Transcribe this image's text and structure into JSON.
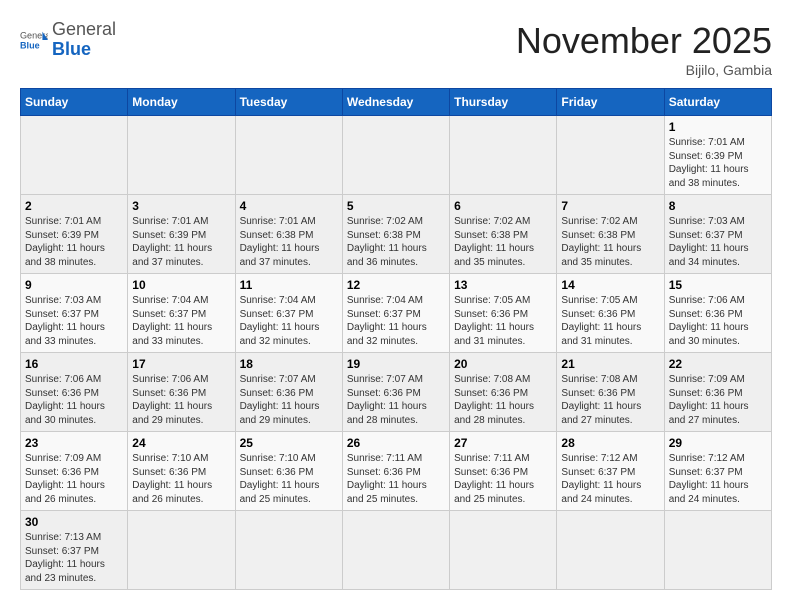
{
  "header": {
    "logo_general": "General",
    "logo_blue": "Blue",
    "month_title": "November 2025",
    "location": "Bijilo, Gambia"
  },
  "weekdays": [
    "Sunday",
    "Monday",
    "Tuesday",
    "Wednesday",
    "Thursday",
    "Friday",
    "Saturday"
  ],
  "weeks": [
    [
      {
        "day": "",
        "info": ""
      },
      {
        "day": "",
        "info": ""
      },
      {
        "day": "",
        "info": ""
      },
      {
        "day": "",
        "info": ""
      },
      {
        "day": "",
        "info": ""
      },
      {
        "day": "",
        "info": ""
      },
      {
        "day": "1",
        "info": "Sunrise: 7:01 AM\nSunset: 6:39 PM\nDaylight: 11 hours\nand 38 minutes."
      }
    ],
    [
      {
        "day": "2",
        "info": "Sunrise: 7:01 AM\nSunset: 6:39 PM\nDaylight: 11 hours\nand 38 minutes."
      },
      {
        "day": "3",
        "info": "Sunrise: 7:01 AM\nSunset: 6:39 PM\nDaylight: 11 hours\nand 37 minutes."
      },
      {
        "day": "4",
        "info": "Sunrise: 7:01 AM\nSunset: 6:38 PM\nDaylight: 11 hours\nand 37 minutes."
      },
      {
        "day": "5",
        "info": "Sunrise: 7:02 AM\nSunset: 6:38 PM\nDaylight: 11 hours\nand 36 minutes."
      },
      {
        "day": "6",
        "info": "Sunrise: 7:02 AM\nSunset: 6:38 PM\nDaylight: 11 hours\nand 35 minutes."
      },
      {
        "day": "7",
        "info": "Sunrise: 7:02 AM\nSunset: 6:38 PM\nDaylight: 11 hours\nand 35 minutes."
      },
      {
        "day": "8",
        "info": "Sunrise: 7:03 AM\nSunset: 6:37 PM\nDaylight: 11 hours\nand 34 minutes."
      }
    ],
    [
      {
        "day": "9",
        "info": "Sunrise: 7:03 AM\nSunset: 6:37 PM\nDaylight: 11 hours\nand 33 minutes."
      },
      {
        "day": "10",
        "info": "Sunrise: 7:04 AM\nSunset: 6:37 PM\nDaylight: 11 hours\nand 33 minutes."
      },
      {
        "day": "11",
        "info": "Sunrise: 7:04 AM\nSunset: 6:37 PM\nDaylight: 11 hours\nand 32 minutes."
      },
      {
        "day": "12",
        "info": "Sunrise: 7:04 AM\nSunset: 6:37 PM\nDaylight: 11 hours\nand 32 minutes."
      },
      {
        "day": "13",
        "info": "Sunrise: 7:05 AM\nSunset: 6:36 PM\nDaylight: 11 hours\nand 31 minutes."
      },
      {
        "day": "14",
        "info": "Sunrise: 7:05 AM\nSunset: 6:36 PM\nDaylight: 11 hours\nand 31 minutes."
      },
      {
        "day": "15",
        "info": "Sunrise: 7:06 AM\nSunset: 6:36 PM\nDaylight: 11 hours\nand 30 minutes."
      }
    ],
    [
      {
        "day": "16",
        "info": "Sunrise: 7:06 AM\nSunset: 6:36 PM\nDaylight: 11 hours\nand 30 minutes."
      },
      {
        "day": "17",
        "info": "Sunrise: 7:06 AM\nSunset: 6:36 PM\nDaylight: 11 hours\nand 29 minutes."
      },
      {
        "day": "18",
        "info": "Sunrise: 7:07 AM\nSunset: 6:36 PM\nDaylight: 11 hours\nand 29 minutes."
      },
      {
        "day": "19",
        "info": "Sunrise: 7:07 AM\nSunset: 6:36 PM\nDaylight: 11 hours\nand 28 minutes."
      },
      {
        "day": "20",
        "info": "Sunrise: 7:08 AM\nSunset: 6:36 PM\nDaylight: 11 hours\nand 28 minutes."
      },
      {
        "day": "21",
        "info": "Sunrise: 7:08 AM\nSunset: 6:36 PM\nDaylight: 11 hours\nand 27 minutes."
      },
      {
        "day": "22",
        "info": "Sunrise: 7:09 AM\nSunset: 6:36 PM\nDaylight: 11 hours\nand 27 minutes."
      }
    ],
    [
      {
        "day": "23",
        "info": "Sunrise: 7:09 AM\nSunset: 6:36 PM\nDaylight: 11 hours\nand 26 minutes."
      },
      {
        "day": "24",
        "info": "Sunrise: 7:10 AM\nSunset: 6:36 PM\nDaylight: 11 hours\nand 26 minutes."
      },
      {
        "day": "25",
        "info": "Sunrise: 7:10 AM\nSunset: 6:36 PM\nDaylight: 11 hours\nand 25 minutes."
      },
      {
        "day": "26",
        "info": "Sunrise: 7:11 AM\nSunset: 6:36 PM\nDaylight: 11 hours\nand 25 minutes."
      },
      {
        "day": "27",
        "info": "Sunrise: 7:11 AM\nSunset: 6:36 PM\nDaylight: 11 hours\nand 25 minutes."
      },
      {
        "day": "28",
        "info": "Sunrise: 7:12 AM\nSunset: 6:37 PM\nDaylight: 11 hours\nand 24 minutes."
      },
      {
        "day": "29",
        "info": "Sunrise: 7:12 AM\nSunset: 6:37 PM\nDaylight: 11 hours\nand 24 minutes."
      }
    ],
    [
      {
        "day": "30",
        "info": "Sunrise: 7:13 AM\nSunset: 6:37 PM\nDaylight: 11 hours\nand 23 minutes."
      },
      {
        "day": "",
        "info": ""
      },
      {
        "day": "",
        "info": ""
      },
      {
        "day": "",
        "info": ""
      },
      {
        "day": "",
        "info": ""
      },
      {
        "day": "",
        "info": ""
      },
      {
        "day": "",
        "info": ""
      }
    ]
  ]
}
